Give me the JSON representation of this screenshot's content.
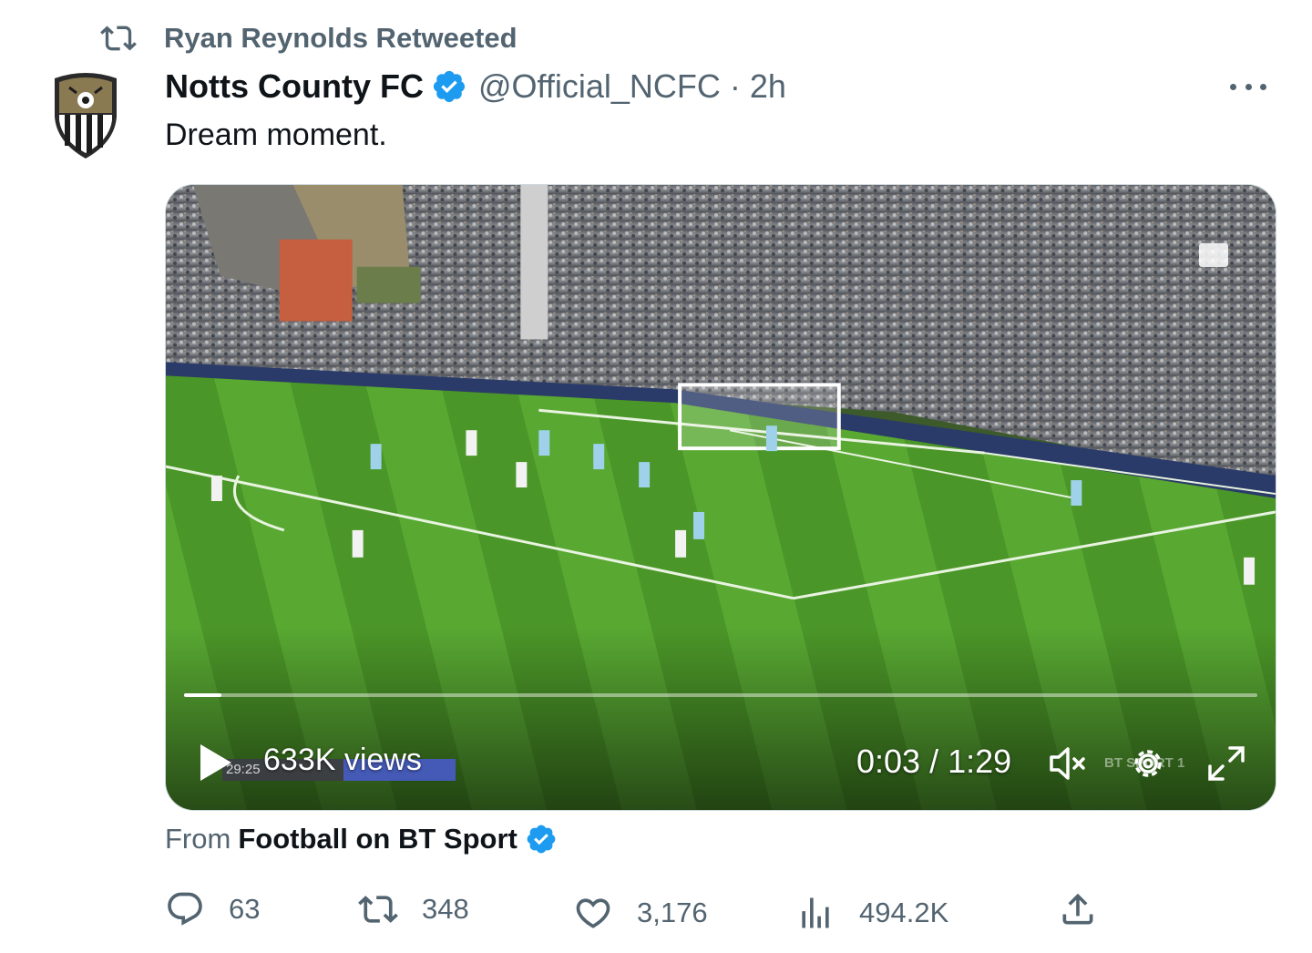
{
  "retweet_banner": {
    "text": "Ryan Reynolds Retweeted",
    "icon": "retweet-icon"
  },
  "author": {
    "display_name": "Notts County FC",
    "handle": "@Official_NCFC",
    "separator": "·",
    "time": "2h",
    "verified": true,
    "avatar": "notts-county-crest"
  },
  "tweet": {
    "text": "Dream moment."
  },
  "video": {
    "views": "633K views",
    "elapsed": "0:03",
    "duration": "1:29",
    "timecode": "0:03 / 1:29",
    "progress_fraction": 0.035,
    "muted": true,
    "broadcast_clock": "29:25",
    "broadcaster_watermark": "BT SPORT 1"
  },
  "source": {
    "prefix": "From",
    "name": "Football on BT Sport",
    "verified": true
  },
  "actions": {
    "replies": "63",
    "retweets": "348",
    "likes": "3,176",
    "views": "494.2K"
  },
  "colors": {
    "verified": "#1d9bf0",
    "secondary_text": "#536471",
    "primary_text": "#0f1419",
    "pitch": "#4f9a2c"
  }
}
